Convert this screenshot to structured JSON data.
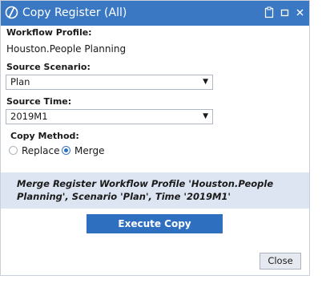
{
  "dialog": {
    "title": "Copy Register (All)",
    "title_icons": [
      "logo-icon",
      "clipboard-icon",
      "maximize-icon",
      "close-icon"
    ]
  },
  "workflow_profile": {
    "label": "Workflow Profile:",
    "value": "Houston.People Planning"
  },
  "source_scenario": {
    "label": "Source Scenario:",
    "selected": "Plan"
  },
  "source_time": {
    "label": "Source Time:",
    "selected": "2019M1"
  },
  "copy_method": {
    "label": "Copy Method:",
    "options": [
      {
        "label": "Replace",
        "checked": false
      },
      {
        "label": "Merge",
        "checked": true
      }
    ]
  },
  "summary": {
    "text": "Merge Register Workflow Profile 'Houston.People Planning', Scenario 'Plan', Time '2019M1'"
  },
  "buttons": {
    "execute": "Execute Copy",
    "close": "Close"
  },
  "colors": {
    "titlebar": "#3a78c3",
    "accent": "#2f6fc0",
    "summary_bg": "#dde5f2"
  }
}
